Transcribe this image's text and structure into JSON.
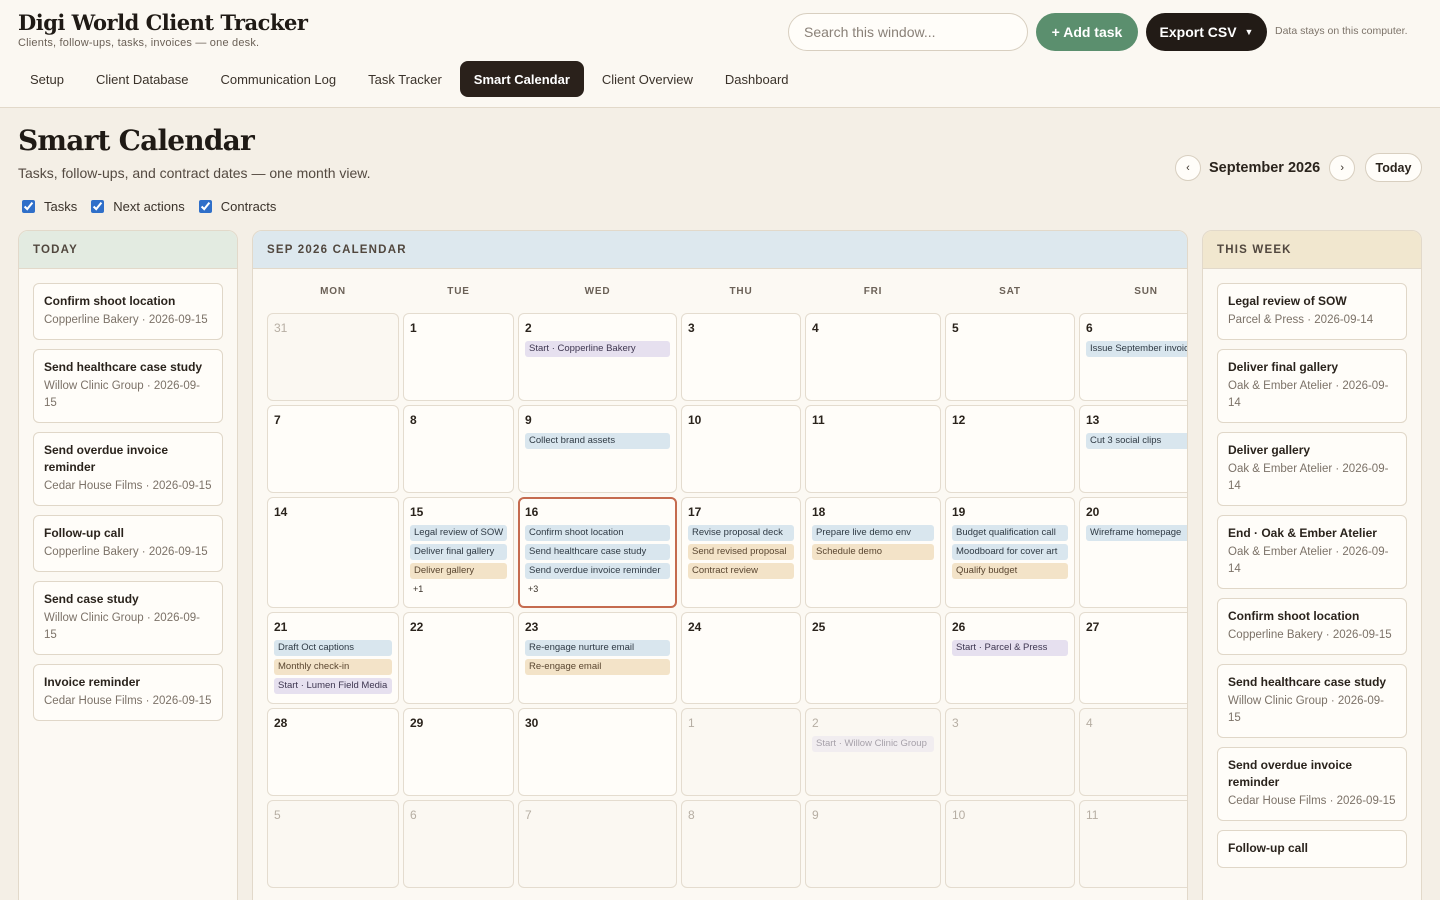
{
  "app": {
    "title": "Digi World Client Tracker",
    "subtitle": "Clients, follow-ups, tasks, invoices — one desk.",
    "search_placeholder": "Search this window...",
    "add_label": "+ Add task",
    "export_label": "Export CSV",
    "privacy_note": "Data stays on this computer."
  },
  "nav": [
    "Setup",
    "Client Database",
    "Communication Log",
    "Task Tracker",
    "Smart Calendar",
    "Client Overview",
    "Dashboard"
  ],
  "nav_active": "Smart Calendar",
  "page": {
    "title": "Smart Calendar",
    "subtitle": "Tasks, follow-ups, and contract dates — one month view.",
    "month_label": "September 2026",
    "prev": "‹",
    "next": "›",
    "today_label": "Today",
    "filters": [
      {
        "label": "Tasks",
        "checked": true
      },
      {
        "label": "Next actions",
        "checked": true
      },
      {
        "label": "Contracts",
        "checked": true
      }
    ]
  },
  "today_panel": {
    "heading": "TODAY",
    "items": [
      {
        "title": "Confirm shoot location",
        "meta": "Copperline Bakery · 2026-09-15"
      },
      {
        "title": "Send healthcare case study",
        "meta": "Willow Clinic Group · 2026-09-15"
      },
      {
        "title": "Send overdue invoice reminder",
        "meta": "Cedar House Films · 2026-09-15"
      },
      {
        "title": "Follow-up call",
        "meta": "Copperline Bakery · 2026-09-15"
      },
      {
        "title": "Send case study",
        "meta": "Willow Clinic Group · 2026-09-15"
      },
      {
        "title": "Invoice reminder",
        "meta": "Cedar House Films · 2026-09-15"
      }
    ]
  },
  "calendar": {
    "heading": "SEP 2026 CALENDAR",
    "weekdays": [
      "MON",
      "TUE",
      "WED",
      "THU",
      "FRI",
      "SAT",
      "SUN"
    ],
    "weeks": [
      [
        {
          "day": "31",
          "outside": true,
          "events": []
        },
        {
          "day": "1",
          "events": []
        },
        {
          "day": "2",
          "events": [
            {
              "label": "Start · Copperline Bakery",
              "kind": "contract"
            }
          ]
        },
        {
          "day": "3",
          "events": []
        },
        {
          "day": "4",
          "events": []
        },
        {
          "day": "5",
          "events": []
        },
        {
          "day": "6",
          "events": [
            {
              "label": "Issue September invoice",
              "kind": "task"
            }
          ]
        }
      ],
      [
        {
          "day": "7",
          "events": []
        },
        {
          "day": "8",
          "events": []
        },
        {
          "day": "9",
          "events": [
            {
              "label": "Collect brand assets",
              "kind": "task"
            }
          ]
        },
        {
          "day": "10",
          "events": []
        },
        {
          "day": "11",
          "events": []
        },
        {
          "day": "12",
          "events": []
        },
        {
          "day": "13",
          "events": [
            {
              "label": "Cut 3 social clips",
              "kind": "task"
            }
          ]
        }
      ],
      [
        {
          "day": "14",
          "events": []
        },
        {
          "day": "15",
          "events": [
            {
              "label": "Legal review of SOW",
              "kind": "task"
            },
            {
              "label": "Deliver final gallery",
              "kind": "task"
            },
            {
              "label": "Deliver gallery",
              "kind": "next"
            }
          ],
          "more": "+1"
        },
        {
          "day": "16",
          "today": true,
          "events": [
            {
              "label": "Confirm shoot location",
              "kind": "task"
            },
            {
              "label": "Send healthcare case study",
              "kind": "task"
            },
            {
              "label": "Send overdue invoice reminder",
              "kind": "task"
            }
          ],
          "more": "+3"
        },
        {
          "day": "17",
          "events": [
            {
              "label": "Revise proposal deck",
              "kind": "task"
            },
            {
              "label": "Send revised proposal",
              "kind": "next"
            },
            {
              "label": "Contract review",
              "kind": "next"
            }
          ]
        },
        {
          "day": "18",
          "events": [
            {
              "label": "Prepare live demo env",
              "kind": "task"
            },
            {
              "label": "Schedule demo",
              "kind": "next"
            }
          ]
        },
        {
          "day": "19",
          "events": [
            {
              "label": "Budget qualification call",
              "kind": "task"
            },
            {
              "label": "Moodboard for cover art",
              "kind": "task"
            },
            {
              "label": "Qualify budget",
              "kind": "next"
            }
          ]
        },
        {
          "day": "20",
          "events": [
            {
              "label": "Wireframe homepage",
              "kind": "task"
            }
          ]
        }
      ],
      [
        {
          "day": "21",
          "events": [
            {
              "label": "Draft Oct captions",
              "kind": "task"
            },
            {
              "label": "Monthly check-in",
              "kind": "next"
            },
            {
              "label": "Start · Lumen Field Media",
              "kind": "contract"
            }
          ]
        },
        {
          "day": "22",
          "events": []
        },
        {
          "day": "23",
          "events": [
            {
              "label": "Re-engage nurture email",
              "kind": "task"
            },
            {
              "label": "Re-engage email",
              "kind": "next"
            }
          ]
        },
        {
          "day": "24",
          "events": []
        },
        {
          "day": "25",
          "events": []
        },
        {
          "day": "26",
          "events": [
            {
              "label": "Start · Parcel & Press",
              "kind": "contract"
            }
          ]
        },
        {
          "day": "27",
          "events": []
        }
      ],
      [
        {
          "day": "28",
          "events": []
        },
        {
          "day": "29",
          "events": []
        },
        {
          "day": "30",
          "events": []
        },
        {
          "day": "1",
          "outside": true,
          "events": []
        },
        {
          "day": "2",
          "outside": true,
          "events": [
            {
              "label": "Start · Willow Clinic Group",
              "kind": "contract"
            }
          ]
        },
        {
          "day": "3",
          "outside": true,
          "events": []
        },
        {
          "day": "4",
          "outside": true,
          "events": []
        }
      ],
      [
        {
          "day": "5",
          "outside": true,
          "events": []
        },
        {
          "day": "6",
          "outside": true,
          "events": []
        },
        {
          "day": "7",
          "outside": true,
          "events": []
        },
        {
          "day": "8",
          "outside": true,
          "events": []
        },
        {
          "day": "9",
          "outside": true,
          "events": []
        },
        {
          "day": "10",
          "outside": true,
          "events": []
        },
        {
          "day": "11",
          "outside": true,
          "events": []
        }
      ]
    ]
  },
  "week_panel": {
    "heading": "THIS WEEK",
    "items": [
      {
        "title": "Legal review of SOW",
        "meta": "Parcel & Press · 2026-09-14"
      },
      {
        "title": "Deliver final gallery",
        "meta": "Oak & Ember Atelier · 2026-09-14"
      },
      {
        "title": "Deliver gallery",
        "meta": "Oak & Ember Atelier · 2026-09-14"
      },
      {
        "title": "End · Oak & Ember Atelier",
        "meta": "Oak & Ember Atelier · 2026-09-14"
      },
      {
        "title": "Confirm shoot location",
        "meta": "Copperline Bakery · 2026-09-15"
      },
      {
        "title": "Send healthcare case study",
        "meta": "Willow Clinic Group · 2026-09-15"
      },
      {
        "title": "Send overdue invoice reminder",
        "meta": "Cedar House Films · 2026-09-15"
      },
      {
        "title": "Follow-up call",
        "meta": ""
      }
    ]
  }
}
